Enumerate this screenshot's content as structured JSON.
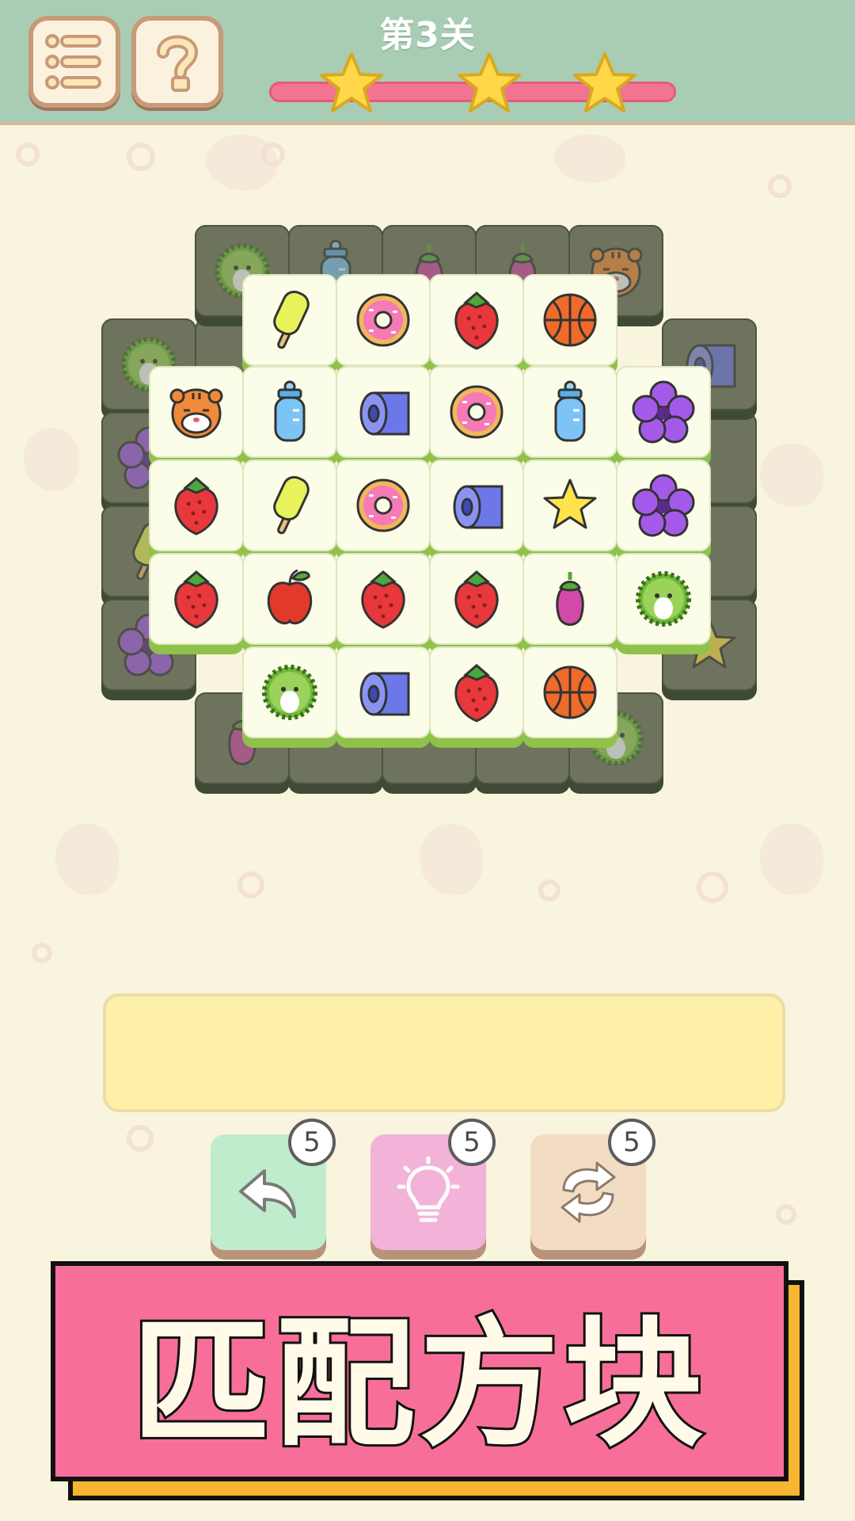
{
  "header": {
    "level_title": "第3关",
    "menu_icon": "menu-list-icon",
    "help_icon": "question-mark-icon",
    "stars_earned": 3,
    "stars_total": 3,
    "colors": {
      "header_bg": "#a9cdb4",
      "progress": "#f27490",
      "star": "#ffd84a"
    }
  },
  "board": {
    "top_layer": [
      [
        "popsicle",
        "donut",
        "strawberry",
        "basketball"
      ],
      [
        "tiger",
        "baby-bottle",
        "toilet-paper",
        "donut",
        "baby-bottle",
        "flower"
      ],
      [
        "strawberry",
        "popsicle",
        "donut",
        "toilet-paper",
        "star",
        "flower"
      ],
      [
        "strawberry",
        "apple",
        "strawberry",
        "strawberry",
        "eggplant",
        "durian"
      ],
      [
        "durian",
        "toilet-paper",
        "strawberry",
        "basketball"
      ]
    ],
    "lower_layer_visible": [
      "durian",
      "baby-bottle",
      "eggplant",
      "eggplant",
      "tiger",
      "durian",
      "toilet-paper",
      "flower",
      "popsicle",
      "flower",
      "eggplant",
      "star",
      "durian"
    ]
  },
  "tray": {
    "slots_filled": 0
  },
  "tools": [
    {
      "id": "undo",
      "icon": "undo-arrow-icon",
      "count": "5",
      "color": "#bfeccd"
    },
    {
      "id": "hint",
      "icon": "lightbulb-icon",
      "count": "5",
      "color": "#f3b3d8"
    },
    {
      "id": "shuffle",
      "icon": "shuffle-icon",
      "count": "5",
      "color": "#f3dcc4"
    }
  ],
  "banner": {
    "text": "匹配方块",
    "bg": "#f76f98",
    "shadow": "#f8b531"
  }
}
